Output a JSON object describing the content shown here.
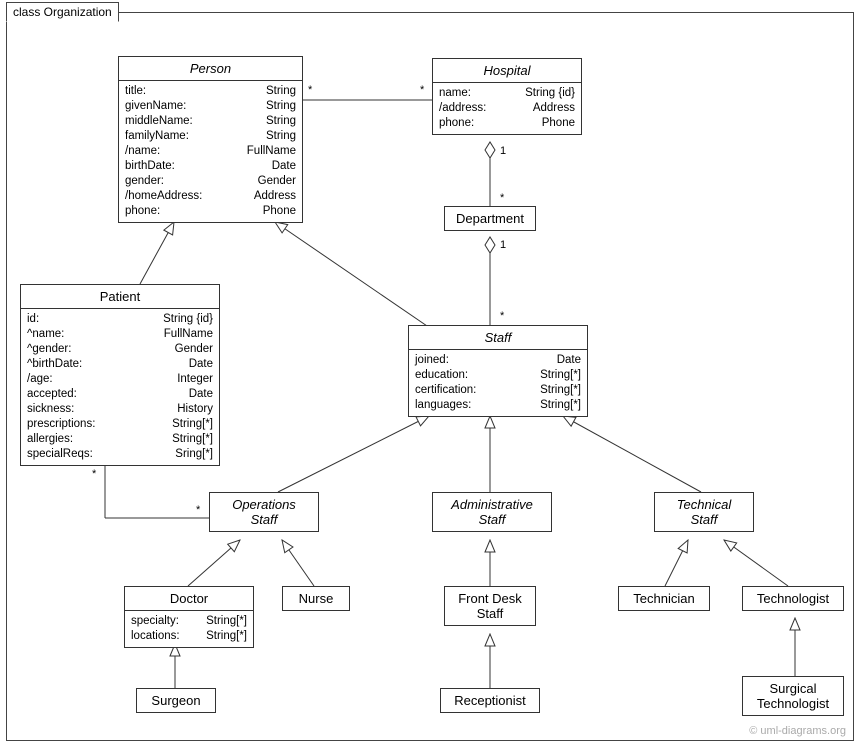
{
  "frame_title": "class Organization",
  "watermark": "© uml-diagrams.org",
  "classes": {
    "person": {
      "name": "Person",
      "attrs": [
        {
          "n": "title:",
          "t": "String"
        },
        {
          "n": "givenName:",
          "t": "String"
        },
        {
          "n": "middleName:",
          "t": "String"
        },
        {
          "n": "familyName:",
          "t": "String"
        },
        {
          "n": "/name:",
          "t": "FullName"
        },
        {
          "n": "birthDate:",
          "t": "Date"
        },
        {
          "n": "gender:",
          "t": "Gender"
        },
        {
          "n": "/homeAddress:",
          "t": "Address"
        },
        {
          "n": "phone:",
          "t": "Phone"
        }
      ]
    },
    "hospital": {
      "name": "Hospital",
      "attrs": [
        {
          "n": "name:",
          "t": "String {id}"
        },
        {
          "n": "/address:",
          "t": "Address"
        },
        {
          "n": "phone:",
          "t": "Phone"
        }
      ]
    },
    "department": {
      "name": "Department"
    },
    "patient": {
      "name": "Patient",
      "attrs": [
        {
          "n": "id:",
          "t": "String {id}"
        },
        {
          "n": "^name:",
          "t": "FullName"
        },
        {
          "n": "^gender:",
          "t": "Gender"
        },
        {
          "n": "^birthDate:",
          "t": "Date"
        },
        {
          "n": "/age:",
          "t": "Integer"
        },
        {
          "n": "accepted:",
          "t": "Date"
        },
        {
          "n": "sickness:",
          "t": "History"
        },
        {
          "n": "prescriptions:",
          "t": "String[*]"
        },
        {
          "n": "allergies:",
          "t": "String[*]"
        },
        {
          "n": "specialReqs:",
          "t": "Sring[*]"
        }
      ]
    },
    "staff": {
      "name": "Staff",
      "attrs": [
        {
          "n": "joined:",
          "t": "Date"
        },
        {
          "n": "education:",
          "t": "String[*]"
        },
        {
          "n": "certification:",
          "t": "String[*]"
        },
        {
          "n": "languages:",
          "t": "String[*]"
        }
      ]
    },
    "ops": {
      "name": "Operations",
      "sub": "Staff"
    },
    "admin": {
      "name": "Administrative",
      "sub": "Staff"
    },
    "tech": {
      "name": "Technical",
      "sub": "Staff"
    },
    "doctor": {
      "name": "Doctor",
      "attrs": [
        {
          "n": "specialty:",
          "t": "String[*]"
        },
        {
          "n": "locations:",
          "t": "String[*]"
        }
      ]
    },
    "nurse": {
      "name": "Nurse"
    },
    "frontdesk": {
      "name": "Front Desk",
      "sub": "Staff"
    },
    "technician": {
      "name": "Technician"
    },
    "technologist": {
      "name": "Technologist"
    },
    "surgeon": {
      "name": "Surgeon"
    },
    "receptionist": {
      "name": "Receptionist"
    },
    "surgtech": {
      "name": "Surgical",
      "sub": "Technologist"
    }
  },
  "mult": {
    "person_hosp_left": "*",
    "person_hosp_right": "*",
    "hosp_dept_top": "1",
    "hosp_dept_bottom": "*",
    "dept_staff_top": "1",
    "dept_staff_bottom": "*",
    "patient_ops_p": "*",
    "patient_ops_o": "*"
  }
}
